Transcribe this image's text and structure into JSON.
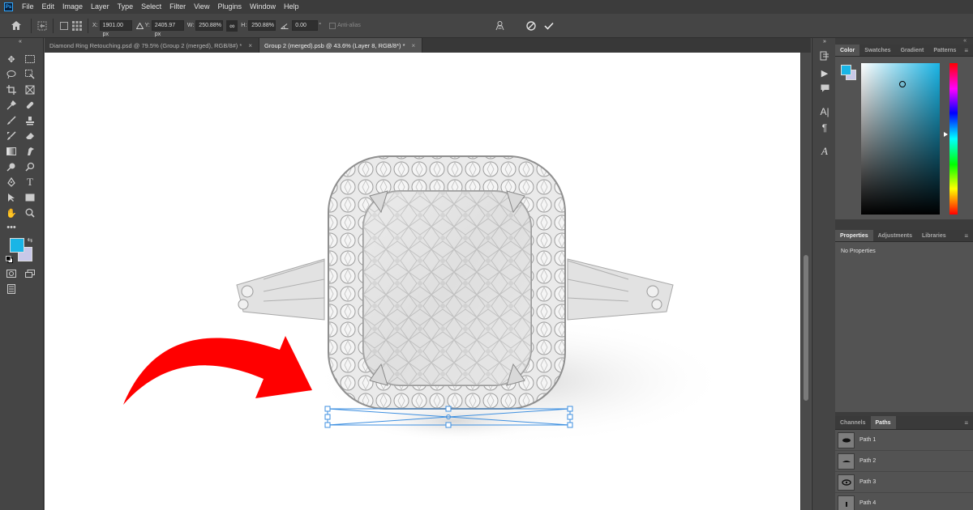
{
  "app": {
    "logo": "Ps"
  },
  "menu": [
    "File",
    "Edit",
    "Image",
    "Layer",
    "Type",
    "Select",
    "Filter",
    "View",
    "Plugins",
    "Window",
    "Help"
  ],
  "options": {
    "x_label": "X:",
    "x_value": "1901.00 px",
    "y_label": "Y:",
    "y_value": "2405.97 px",
    "w_label": "W:",
    "w_value": "250.88%",
    "h_label": "H:",
    "h_value": "250.88%",
    "angle_value": "0.00",
    "angle_unit": "°",
    "antialias_label": "Anti-alias"
  },
  "tabs": [
    {
      "label": "Diamond Ring Retouching.psd @ 79.5% (Group 2 (merged), RGB/8#) *",
      "close": "×"
    },
    {
      "label": "Group 2 (merged).psb @ 43.6% (Layer 8, RGB/8*) *",
      "close": "×"
    }
  ],
  "color_panel": {
    "tabs": [
      "Color",
      "Swatches",
      "Gradient",
      "Patterns"
    ],
    "foreground": "#19b5e6",
    "background": "#c8c8e8"
  },
  "properties_panel": {
    "tabs": [
      "Properties",
      "Adjustments",
      "Libraries"
    ],
    "message": "No Properties"
  },
  "paths_panel": {
    "tabs": [
      "Channels",
      "Paths"
    ],
    "paths": [
      "Path 1",
      "Path 2",
      "Path 3",
      "Path 4"
    ]
  },
  "colors": {
    "accent": "#31a8ff",
    "arrow": "#ff0000",
    "transform_box": "#3d8fe0"
  },
  "canvas_illustration": "diamond-ring-with-cushion-cut-center-stone"
}
